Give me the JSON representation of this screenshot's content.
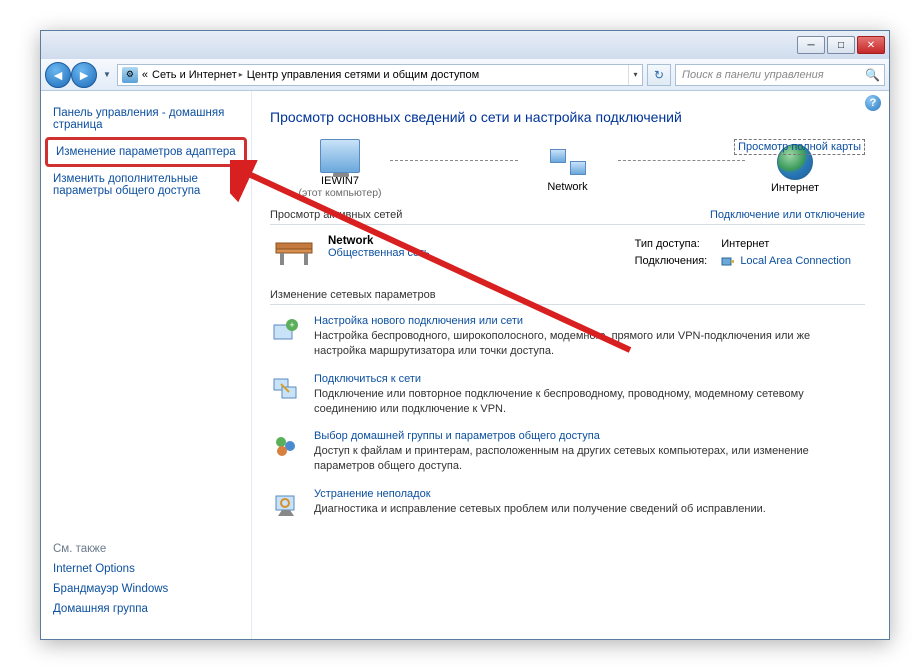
{
  "breadcrumb": {
    "prefix": "«",
    "seg1": "Сеть и Интернет",
    "seg2": "Центр управления сетями и общим доступом"
  },
  "search": {
    "placeholder": "Поиск в панели управления"
  },
  "sidebar": {
    "home": "Панель управления - домашняя страница",
    "adapter": "Изменение параметров адаптера",
    "advanced": "Изменить дополнительные параметры общего доступа",
    "see_also": "См. также",
    "internet_options": "Internet Options",
    "firewall": "Брандмауэр Windows",
    "homegroup": "Домашняя группа"
  },
  "main": {
    "heading": "Просмотр основных сведений о сети и настройка подключений",
    "fullmap": "Просмотр полной карты",
    "topo": {
      "pc_name": "IEWIN7",
      "pc_sub": "(этот компьютер)",
      "network": "Network",
      "internet": "Интернет"
    },
    "active_hdr": "Просмотр активных сетей",
    "active_link": "Подключение или отключение",
    "network": {
      "name": "Network",
      "type": "Общественная сеть",
      "access_lbl": "Тип доступа:",
      "access_val": "Интернет",
      "conn_lbl": "Подключения:",
      "conn_val": "Local Area Connection"
    },
    "settings_hdr": "Изменение сетевых параметров",
    "items": [
      {
        "title": "Настройка нового подключения или сети",
        "desc": "Настройка беспроводного, широкополосного, модемного, прямого или VPN-подключения или же настройка маршрутизатора или точки доступа."
      },
      {
        "title": "Подключиться к сети",
        "desc": "Подключение или повторное подключение к беспроводному, проводному, модемному сетевому соединению или подключение к VPN."
      },
      {
        "title": "Выбор домашней группы и параметров общего доступа",
        "desc": "Доступ к файлам и принтерам, расположенным на других сетевых компьютерах, или изменение параметров общего доступа."
      },
      {
        "title": "Устранение неполадок",
        "desc": "Диагностика и исправление сетевых проблем или получение сведений об исправлении."
      }
    ]
  }
}
